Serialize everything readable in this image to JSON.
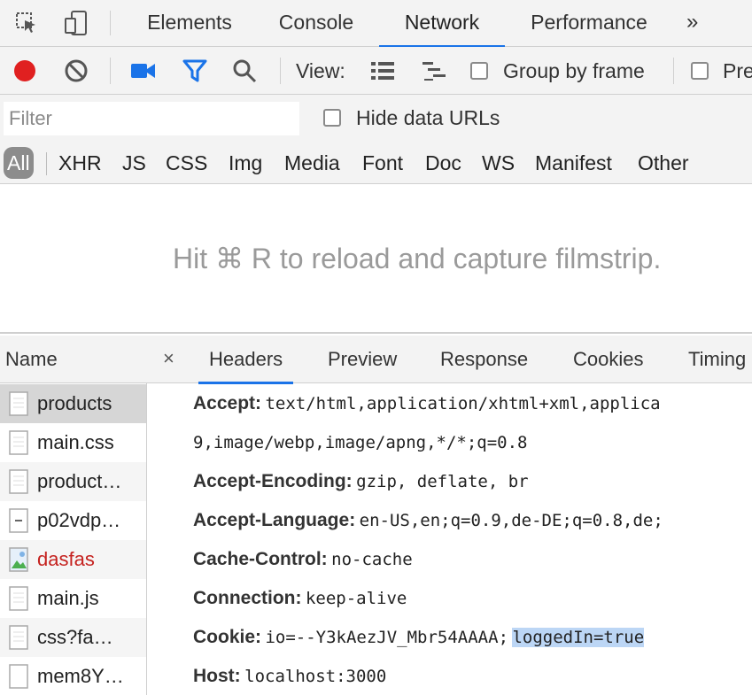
{
  "tabs": [
    {
      "label": "Elements"
    },
    {
      "label": "Console"
    },
    {
      "label": "Network",
      "active": true
    },
    {
      "label": "Performance"
    }
  ],
  "more_label": "»",
  "toolbar": {
    "view_label": "View:",
    "group_by_frame_label": "Group by frame",
    "preserve_label": "Pre",
    "record_color": "#e02020",
    "accent_color": "#1a73e8"
  },
  "filter": {
    "placeholder": "Filter",
    "hide_data_urls_label": "Hide data URLs"
  },
  "types": [
    "All",
    "XHR",
    "JS",
    "CSS",
    "Img",
    "Media",
    "Font",
    "Doc",
    "WS",
    "Manifest",
    "Other"
  ],
  "filmstrip": {
    "message": "Hit ⌘ R to reload and capture filmstrip."
  },
  "requests": {
    "header": "Name",
    "items": [
      {
        "name": "products",
        "icon": "document-icon"
      },
      {
        "name": "main.css",
        "icon": "document-icon"
      },
      {
        "name": "product…",
        "icon": "document-icon"
      },
      {
        "name": "p02vdp…",
        "icon": "script-icon"
      },
      {
        "name": "dasfas",
        "icon": "image-icon",
        "error": true
      },
      {
        "name": "main.js",
        "icon": "document-icon"
      },
      {
        "name": "css?fa…",
        "icon": "document-icon"
      },
      {
        "name": "mem8Y…",
        "icon": "blank-file-icon"
      }
    ]
  },
  "details": {
    "close": "×",
    "tabs": [
      "Headers",
      "Preview",
      "Response",
      "Cookies",
      "Timing"
    ],
    "headers": [
      {
        "key": "Accept:",
        "value": "text/html,application/xhtml+xml,applica"
      },
      {
        "key": "",
        "value": "9,image/webp,image/apng,*/*;q=0.8"
      },
      {
        "key": "Accept-Encoding:",
        "value": "gzip, deflate, br"
      },
      {
        "key": "Accept-Language:",
        "value": "en-US,en;q=0.9,de-DE;q=0.8,de;"
      },
      {
        "key": "Cache-Control:",
        "value": "no-cache"
      },
      {
        "key": "Connection:",
        "value": "keep-alive"
      },
      {
        "key": "Cookie:",
        "value": "io=--Y3kAezJV_Mbr54AAAA;",
        "highlight": "loggedIn=true"
      },
      {
        "key": "Host:",
        "value": "localhost:3000"
      }
    ]
  }
}
